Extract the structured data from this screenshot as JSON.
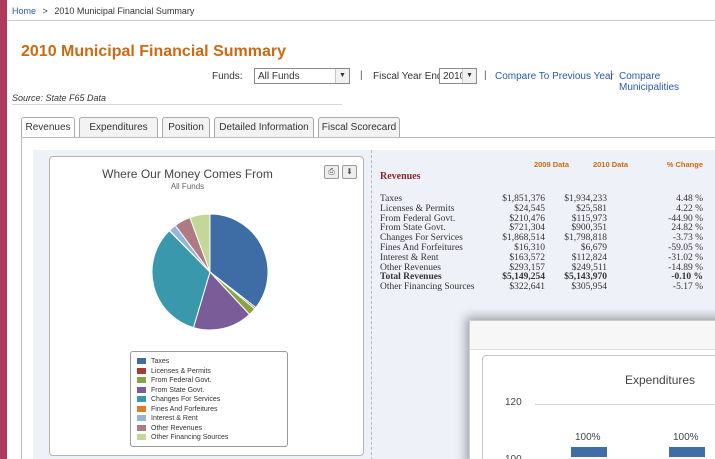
{
  "breadcrumb": {
    "home": "Home",
    "separator": ">",
    "current": "2010 Municipal Financial Summary"
  },
  "page_title": "2010 Municipal Financial Summary",
  "controls": {
    "funds_label": "Funds:",
    "funds_value": "All Funds",
    "separator": "|",
    "fiscal_label": "Fiscal Year End:",
    "fiscal_value": "2010",
    "compare_prev": "Compare To Previous Year",
    "compare_muni": "Compare Municipalities"
  },
  "source": "Source: State F65 Data",
  "tabs": [
    "Revenues",
    "Expenditures",
    "Position",
    "Detailed Information",
    "Fiscal Scorecard"
  ],
  "active_tab": 0,
  "chart_panel": {
    "print_icon": "printer-icon",
    "export_icon": "download-icon"
  },
  "chart_data": [
    {
      "type": "pie",
      "title": "Where Our Money Comes From",
      "subtitle": "All Funds",
      "legend_position": "bottom",
      "slices": [
        {
          "label": "Taxes",
          "value": 1934233,
          "color": "#3e6da6"
        },
        {
          "label": "Licenses & Permits",
          "value": 25581,
          "color": "#a83a3a"
        },
        {
          "label": "From Federal Govt.",
          "value": 115973,
          "color": "#88a443"
        },
        {
          "label": "From State Govt.",
          "value": 900351,
          "color": "#7a5c98"
        },
        {
          "label": "Changes For Services",
          "value": 1798818,
          "color": "#3a98ad"
        },
        {
          "label": "Fines And Forfeitures",
          "value": 6679,
          "color": "#e07b2a"
        },
        {
          "label": "Interest & Rent",
          "value": 112824,
          "color": "#94b4d8"
        },
        {
          "label": "Other Revenues",
          "value": 249511,
          "color": "#b07a82"
        },
        {
          "label": "Other Financing Sources",
          "value": 305954,
          "color": "#c4d698"
        }
      ]
    },
    {
      "type": "bar",
      "title": "Expenditures",
      "ylim": [
        100,
        120
      ],
      "yticks": [
        "120",
        "100"
      ],
      "data_labels": [
        "100%",
        "100%"
      ],
      "values": [
        100,
        100
      ],
      "color": "#3f6da6"
    }
  ],
  "revenue_table": {
    "title": "Revenues",
    "headers": [
      "2009 Data",
      "2010 Data",
      "% Change"
    ],
    "rows": [
      {
        "label": "Taxes",
        "y2009": "$1,851,376",
        "y2010": "$1,934,233",
        "change": "4.48 %",
        "bold": false
      },
      {
        "label": "Licenses & Permits",
        "y2009": "$24,545",
        "y2010": "$25,581",
        "change": "4.22 %",
        "bold": false
      },
      {
        "label": "From Federal Govt.",
        "y2009": "$210,476",
        "y2010": "$115,973",
        "change": "-44.90 %",
        "bold": false
      },
      {
        "label": "From State Govt.",
        "y2009": "$721,304",
        "y2010": "$900,351",
        "change": "24.82 %",
        "bold": false
      },
      {
        "label": "Changes For Services",
        "y2009": "$1,868,514",
        "y2010": "$1,798,818",
        "change": "-3.73 %",
        "bold": false
      },
      {
        "label": "Fines And Forfeitures",
        "y2009": "$16,310",
        "y2010": "$6,679",
        "change": "-59.05 %",
        "bold": false
      },
      {
        "label": "Interest & Rent",
        "y2009": "$163,572",
        "y2010": "$112,824",
        "change": "-31.02 %",
        "bold": false
      },
      {
        "label": "Other Revenues",
        "y2009": "$293,157",
        "y2010": "$249,511",
        "change": "-14.89 %",
        "bold": false
      },
      {
        "label": "Total Revenues",
        "y2009": "$5,149,254",
        "y2010": "$5,143,970",
        "change": "-0.10 %",
        "bold": true
      },
      {
        "label": "Other Financing Sources",
        "y2009": "$322,641",
        "y2010": "$305,954",
        "change": "-5.17 %",
        "bold": false
      }
    ]
  }
}
